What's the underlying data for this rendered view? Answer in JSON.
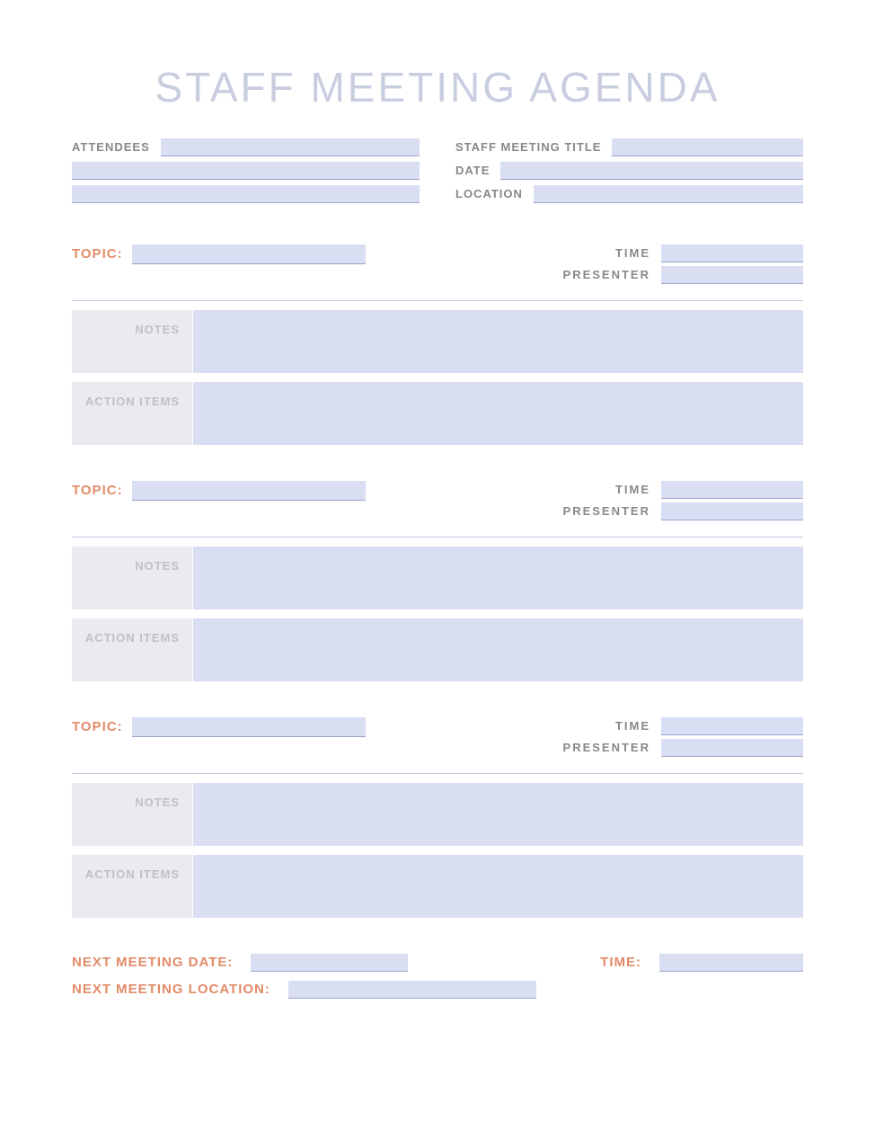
{
  "title": "STAFF MEETING AGENDA",
  "header": {
    "attendees_label": "ATTENDEES",
    "meeting_title_label": "STAFF MEETING TITLE",
    "date_label": "DATE",
    "location_label": "LOCATION"
  },
  "topics": [
    {
      "topic_label": "TOPIC:",
      "time_label": "TIME",
      "presenter_label": "PRESENTER",
      "notes_label": "NOTES",
      "action_label": "ACTION ITEMS"
    },
    {
      "topic_label": "TOPIC:",
      "time_label": "TIME",
      "presenter_label": "PRESENTER",
      "notes_label": "NOTES",
      "action_label": "ACTION ITEMS"
    },
    {
      "topic_label": "TOPIC:",
      "time_label": "TIME",
      "presenter_label": "PRESENTER",
      "notes_label": "NOTES",
      "action_label": "ACTION ITEMS"
    }
  ],
  "footer": {
    "next_date_label": "NEXT MEETING DATE:",
    "time_label": "TIME:",
    "next_location_label": "NEXT MEETING LOCATION:"
  }
}
